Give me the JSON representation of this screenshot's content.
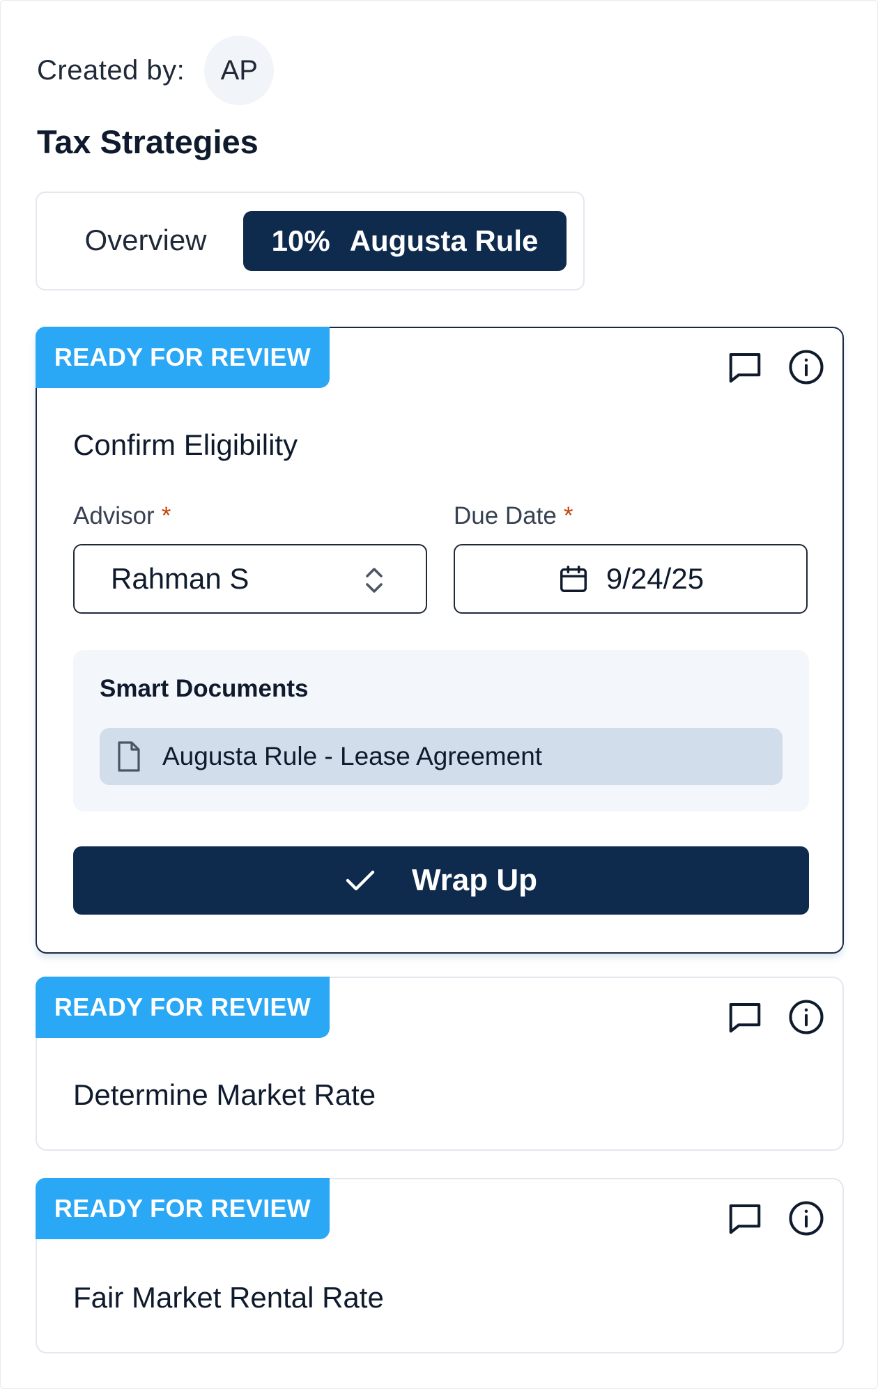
{
  "header": {
    "created_by_label": "Created by:",
    "avatar_initials": "AP",
    "section_title": "Tax Strategies"
  },
  "tabs": {
    "overview_label": "Overview",
    "active_percent": "10%",
    "active_label": "Augusta Rule"
  },
  "tasks": [
    {
      "status": "READY FOR REVIEW",
      "title": "Confirm Eligibility",
      "advisor_label": "Advisor",
      "advisor_value": "Rahman S",
      "due_label": "Due Date",
      "due_value": "9/24/25",
      "required_mark": "*",
      "smart_docs_title": "Smart Documents",
      "documents": [
        "Augusta Rule - Lease Agreement"
      ],
      "wrap_up_label": "Wrap Up"
    },
    {
      "status": "READY FOR REVIEW",
      "title": "Determine Market Rate"
    },
    {
      "status": "READY FOR REVIEW",
      "title": "Fair Market Rental Rate"
    }
  ],
  "colors": {
    "navy": "#0e2a4d",
    "badge_blue": "#2aa7f5",
    "required_orange": "#c2410c",
    "doc_bg": "#d2ddec",
    "panel_bg": "#f3f6fb"
  },
  "icons": {
    "comment": "comment-icon",
    "info": "info-icon",
    "chevrons": "chevron-up-down-icon",
    "calendar": "calendar-icon",
    "document": "document-icon",
    "check": "check-icon"
  }
}
